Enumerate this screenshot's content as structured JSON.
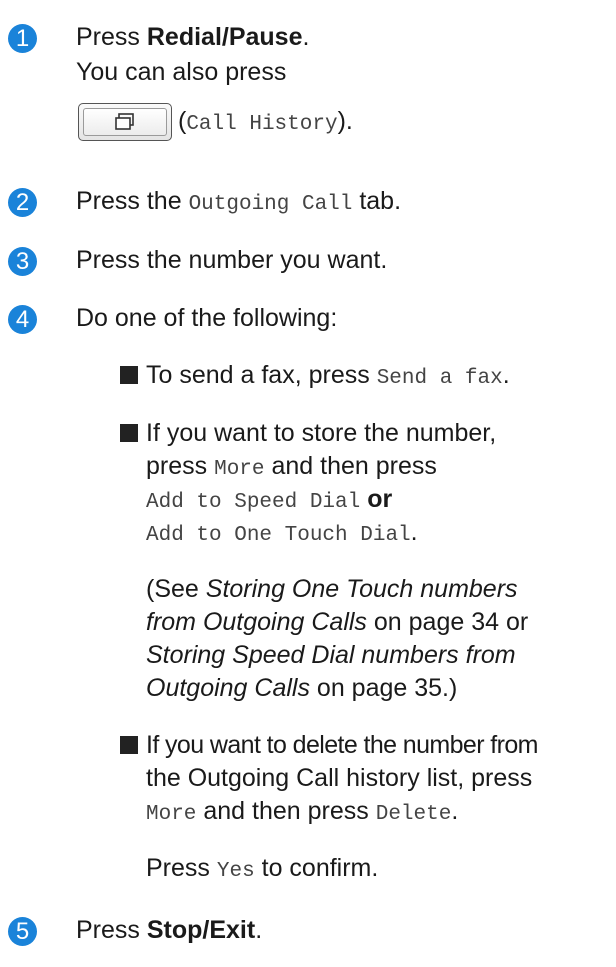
{
  "steps": [
    {
      "n": "1",
      "line1_pre": "Press ",
      "line1_bold": "Redial/Pause",
      "line1_post": ".",
      "line2": "You can also press",
      "paren_open": "(",
      "call_history": "Call History",
      "paren_close": ")."
    },
    {
      "n": "2",
      "pre": "Press the ",
      "mono": "Outgoing Call",
      "post": " tab."
    },
    {
      "n": "3",
      "text": "Press the number you want."
    },
    {
      "n": "4",
      "text": "Do one of the following:"
    },
    {
      "n": "5",
      "pre": "Press ",
      "bold": "Stop/Exit",
      "post": "."
    }
  ],
  "bullet1": {
    "pre": "To send a fax, press ",
    "mono": "Send a fax",
    "post": "."
  },
  "bullet2": {
    "l1": "If you want to store the number,",
    "l2_pre": "press ",
    "l2_mono": "More",
    "l2_post": " and then press",
    "l3_mono": "Add to Speed Dial",
    "l3_post": " or",
    "l4_mono": "Add to One Touch Dial",
    "l4_post": ".",
    "see_pre": "(See ",
    "see_i1": "Storing One Touch numbers",
    "see_i2": "from Outgoing Calls",
    "see_mid1": " on page 34 or",
    "see_i3": "Storing Speed Dial numbers from",
    "see_i4": "Outgoing Calls",
    "see_end": " on page 35.)"
  },
  "bullet3": {
    "l1": "If you want to delete the number from",
    "l2": "the Outgoing Call history list, press",
    "l3_mono1": "More",
    "l3_mid": " and then press ",
    "l3_mono2": "Delete",
    "l3_post": ".",
    "confirm_pre": "Press ",
    "confirm_mono": "Yes",
    "confirm_post": " to confirm."
  }
}
